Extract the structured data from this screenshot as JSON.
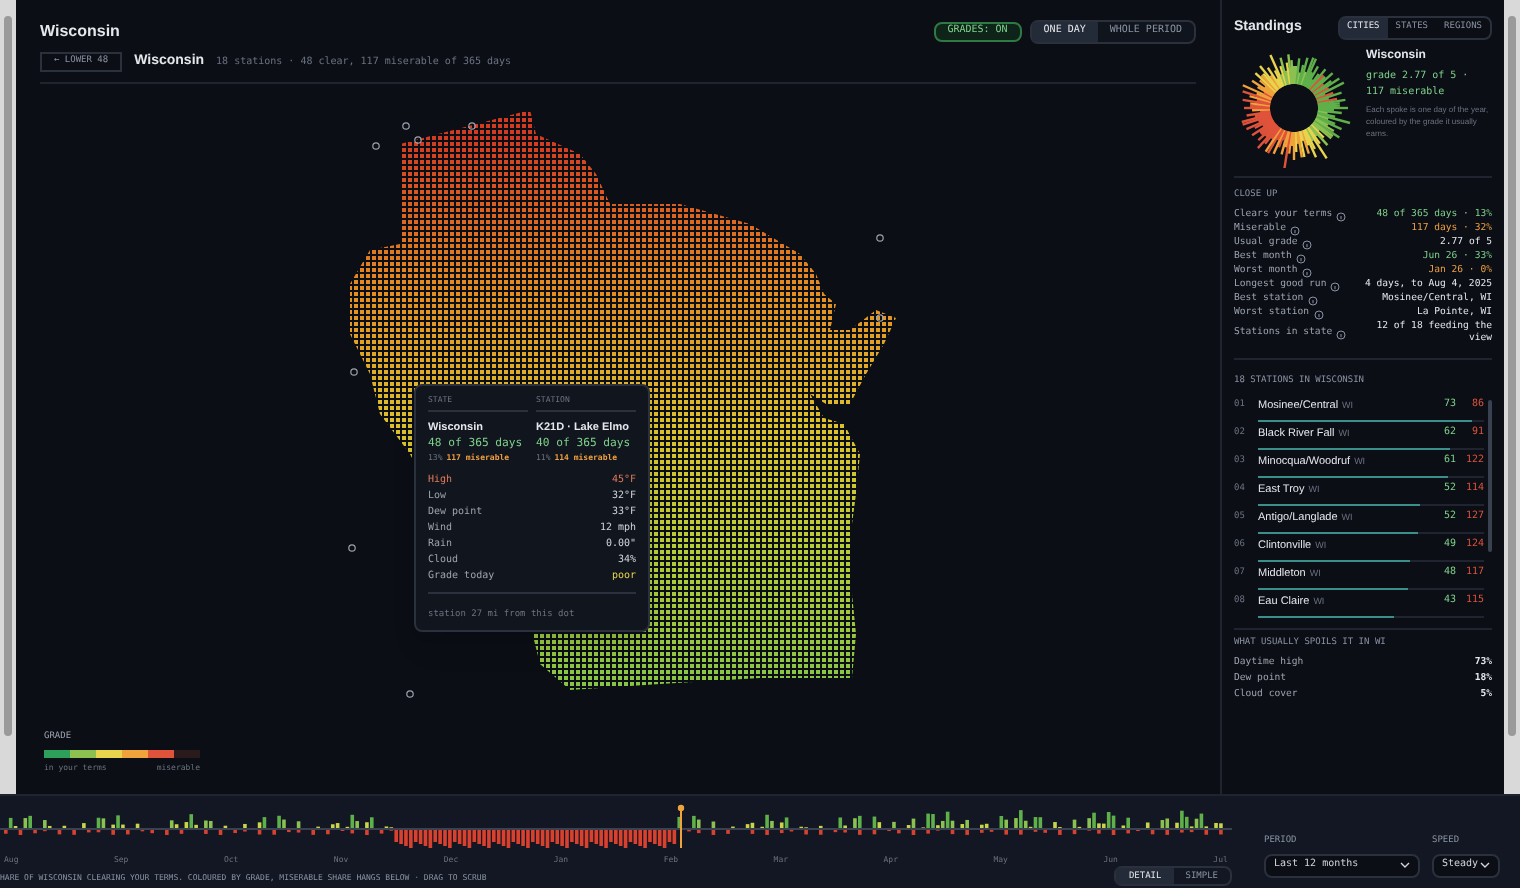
{
  "header": {
    "title": "Wisconsin",
    "grades_toggle": {
      "label": "GRADES: ON",
      "on": true
    },
    "view_modes": [
      {
        "label": "ONE DAY",
        "selected": true
      },
      {
        "label": "WHOLE PERIOD",
        "selected": false
      }
    ]
  },
  "breadcrumb": {
    "back": "← LOWER 48",
    "title": "Wisconsin",
    "summary": "18 stations · 48 clear, 117 miserable of 365 days"
  },
  "tooltip": {
    "columns": [
      {
        "heading": "STATE",
        "name": "Wisconsin",
        "count": "48 of 365 days",
        "share": "13%",
        "miserable": "117 miserable"
      },
      {
        "heading": "STATION",
        "name": "K21D · Lake Elmo",
        "count": "40 of 365 days",
        "share": "11%",
        "miserable": "114 miserable"
      }
    ],
    "rows": [
      {
        "label": "High",
        "value": "45°F",
        "kind": "hot"
      },
      {
        "label": "Low",
        "value": "32°F",
        "kind": "plain"
      },
      {
        "label": "Dew point",
        "value": "33°F",
        "kind": "plain"
      },
      {
        "label": "Wind",
        "value": "12 mph",
        "kind": "plain"
      },
      {
        "label": "Rain",
        "value": "0.00\"",
        "kind": "plain"
      },
      {
        "label": "Cloud",
        "value": "34%",
        "kind": "plain"
      },
      {
        "label": "Grade today",
        "value": "poor",
        "kind": "grade"
      }
    ],
    "footer": "station 27 mi from this dot"
  },
  "legend": {
    "title": "GRADE",
    "segments": [
      {
        "color": "#2e9e5b"
      },
      {
        "color": "#8cc152"
      },
      {
        "color": "#e8d44d"
      },
      {
        "color": "#f0a23b"
      },
      {
        "color": "#e0533a"
      },
      {
        "color": "#2a1a1c"
      }
    ],
    "low_label": "in your terms",
    "high_label": "miserable"
  },
  "standings": {
    "title": "Standings",
    "tabs": [
      {
        "label": "CITIES",
        "selected": true
      },
      {
        "label": "STATES",
        "selected": false
      },
      {
        "label": "REGIONS",
        "selected": false
      }
    ],
    "name": "Wisconsin",
    "grade_line": "grade 2.77 of 5 · 117 miserable",
    "description": "Each spoke is one day of the year, coloured by the grade it usually earns.",
    "close_up_title": "CLOSE UP",
    "close_up": [
      {
        "label": "Clears your terms",
        "value": "48 of 365 days · 13%",
        "kind": "good"
      },
      {
        "label": "Miserable",
        "value": "117 days · 32%",
        "kind": "bad"
      },
      {
        "label": "Usual grade",
        "value": "2.77 of 5",
        "kind": "plain"
      },
      {
        "label": "Best month",
        "value": "Jun 26 · 33%",
        "kind": "good"
      },
      {
        "label": "Worst month",
        "value": "Jan 26 · 0%",
        "kind": "bad"
      },
      {
        "label": "Longest good run",
        "value": "4 days, to Aug 4, 2025",
        "kind": "plain"
      },
      {
        "label": "Best station",
        "value": "Mosinee/Central, WI",
        "kind": "plain"
      },
      {
        "label": "Worst station",
        "value": "La Pointe, WI",
        "kind": "plain"
      },
      {
        "label": "Stations in state",
        "value": "12 of 18 feeding the view",
        "kind": "plain"
      }
    ],
    "stations_title": "18 STATIONS IN WISCONSIN",
    "stations": [
      {
        "rank": "01",
        "name": "Mosinee/Central",
        "state": "WI",
        "clear": "73",
        "miserable": "86",
        "level": 0.95
      },
      {
        "rank": "02",
        "name": "Black River Fall",
        "state": "WI",
        "clear": "62",
        "miserable": "91",
        "level": 0.85
      },
      {
        "rank": "03",
        "name": "Minocqua/Woodruf",
        "state": "WI",
        "clear": "61",
        "miserable": "122",
        "level": 0.84
      },
      {
        "rank": "04",
        "name": "East Troy",
        "state": "WI",
        "clear": "52",
        "miserable": "114",
        "level": 0.72
      },
      {
        "rank": "05",
        "name": "Antigo/Langlade",
        "state": "WI",
        "clear": "52",
        "miserable": "127",
        "level": 0.71
      },
      {
        "rank": "06",
        "name": "Clintonville",
        "state": "WI",
        "clear": "49",
        "miserable": "124",
        "level": 0.67
      },
      {
        "rank": "07",
        "name": "Middleton",
        "state": "WI",
        "clear": "48",
        "miserable": "117",
        "level": 0.66
      },
      {
        "rank": "08",
        "name": "Eau Claire",
        "state": "WI",
        "clear": "43",
        "miserable": "115",
        "level": 0.6
      }
    ],
    "spoils_title": "WHAT USUALLY SPOILS IT IN WI",
    "spoils": [
      {
        "label": "Daytime high",
        "value": "73%"
      },
      {
        "label": "Dew point",
        "value": "18%"
      },
      {
        "label": "Cloud cover",
        "value": "5%"
      }
    ]
  },
  "timeline": {
    "months": [
      "Aug",
      "Sep",
      "Oct",
      "Nov",
      "Dec",
      "Jan",
      "Feb",
      "Mar",
      "Apr",
      "May",
      "Jun",
      "Jul"
    ],
    "caption": "HARE OF WISCONSIN CLEARING YOUR TERMS. COLOURED BY GRADE, MISERABLE SHARE HANGS BELOW · DRAG TO SCRUB",
    "modes": [
      {
        "label": "DETAIL",
        "selected": true
      },
      {
        "label": "SIMPLE",
        "selected": false
      }
    ]
  },
  "period": {
    "label": "PERIOD",
    "value": "Last 12 months"
  },
  "speed": {
    "label": "SPEED",
    "value": "Steady"
  }
}
